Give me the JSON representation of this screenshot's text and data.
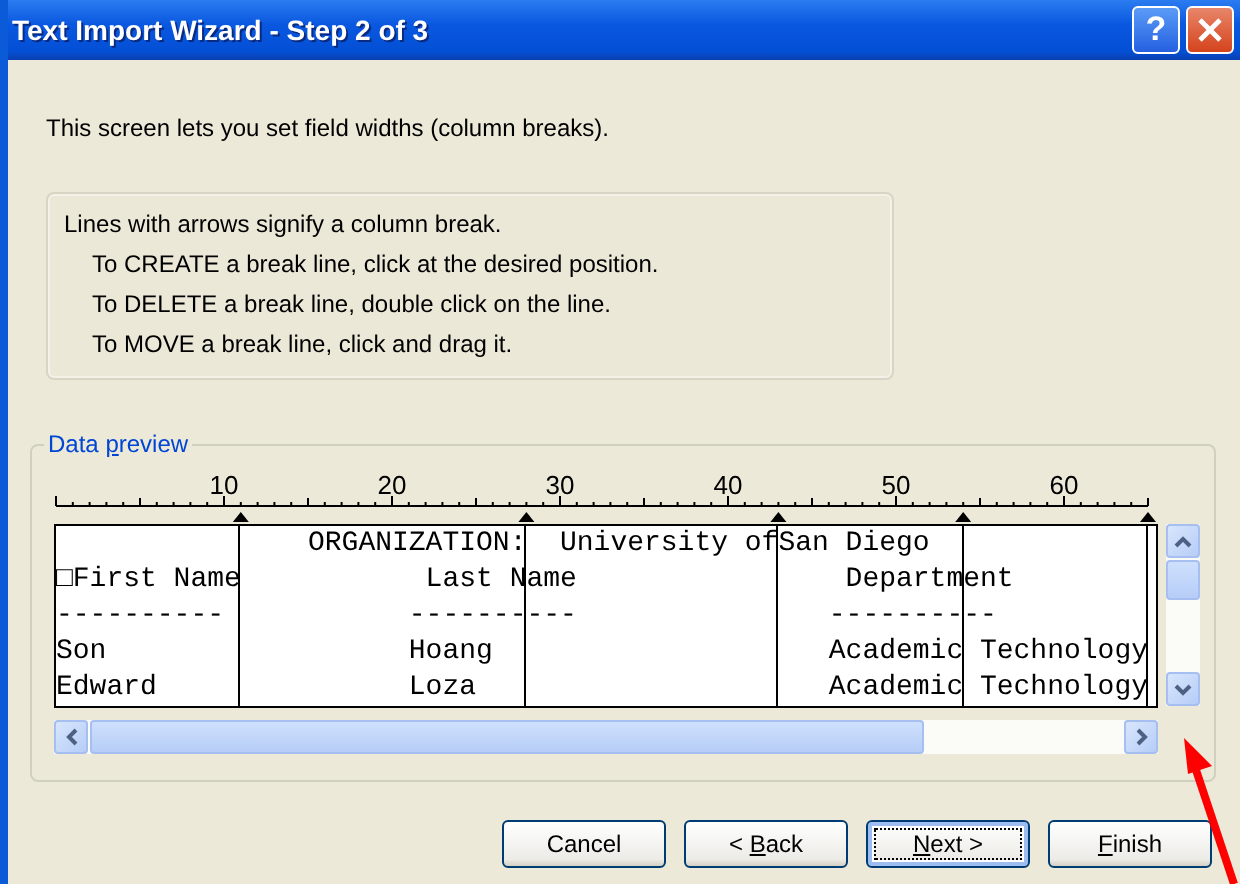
{
  "window": {
    "title": "Text Import Wizard - Step 2 of 3",
    "help_button": "?"
  },
  "intro": "This screen lets you set field widths (column breaks).",
  "instructions": {
    "heading": "Lines with arrows signify a column break.",
    "lines": [
      "To CREATE a break line, click at the desired position.",
      "To DELETE a break line, double click on the line.",
      "To MOVE a break line, click and drag it."
    ]
  },
  "data_preview": {
    "label": {
      "before": "Data ",
      "key": "p",
      "after": "review"
    },
    "ruler_labels": [
      "10",
      "20",
      "30",
      "40",
      "50",
      "60"
    ],
    "rows": [
      [
        null,
        "    ORGANIZATION:",
        "  University of",
        "San Diego",
        null
      ],
      [
        "□First Name",
        "           Last N",
        "ame",
        "    Departm",
        "ent"
      ],
      [
        "----------",
        "          -------",
        "---",
        "   --------",
        "--"
      ],
      [
        "Son",
        "          Hoang",
        null,
        "   Academic",
        " Technology"
      ],
      [
        "Edward",
        "          Loza",
        null,
        "   Academic",
        " Technology"
      ]
    ]
  },
  "buttons": [
    {
      "before": "Cancel",
      "focused": false
    },
    {
      "before": "< ",
      "key": "B",
      "after": "ack",
      "focused": false
    },
    {
      "key": "N",
      "after": "ext >",
      "focused": true
    },
    {
      "key": "F",
      "after": "inish",
      "focused": false
    }
  ]
}
